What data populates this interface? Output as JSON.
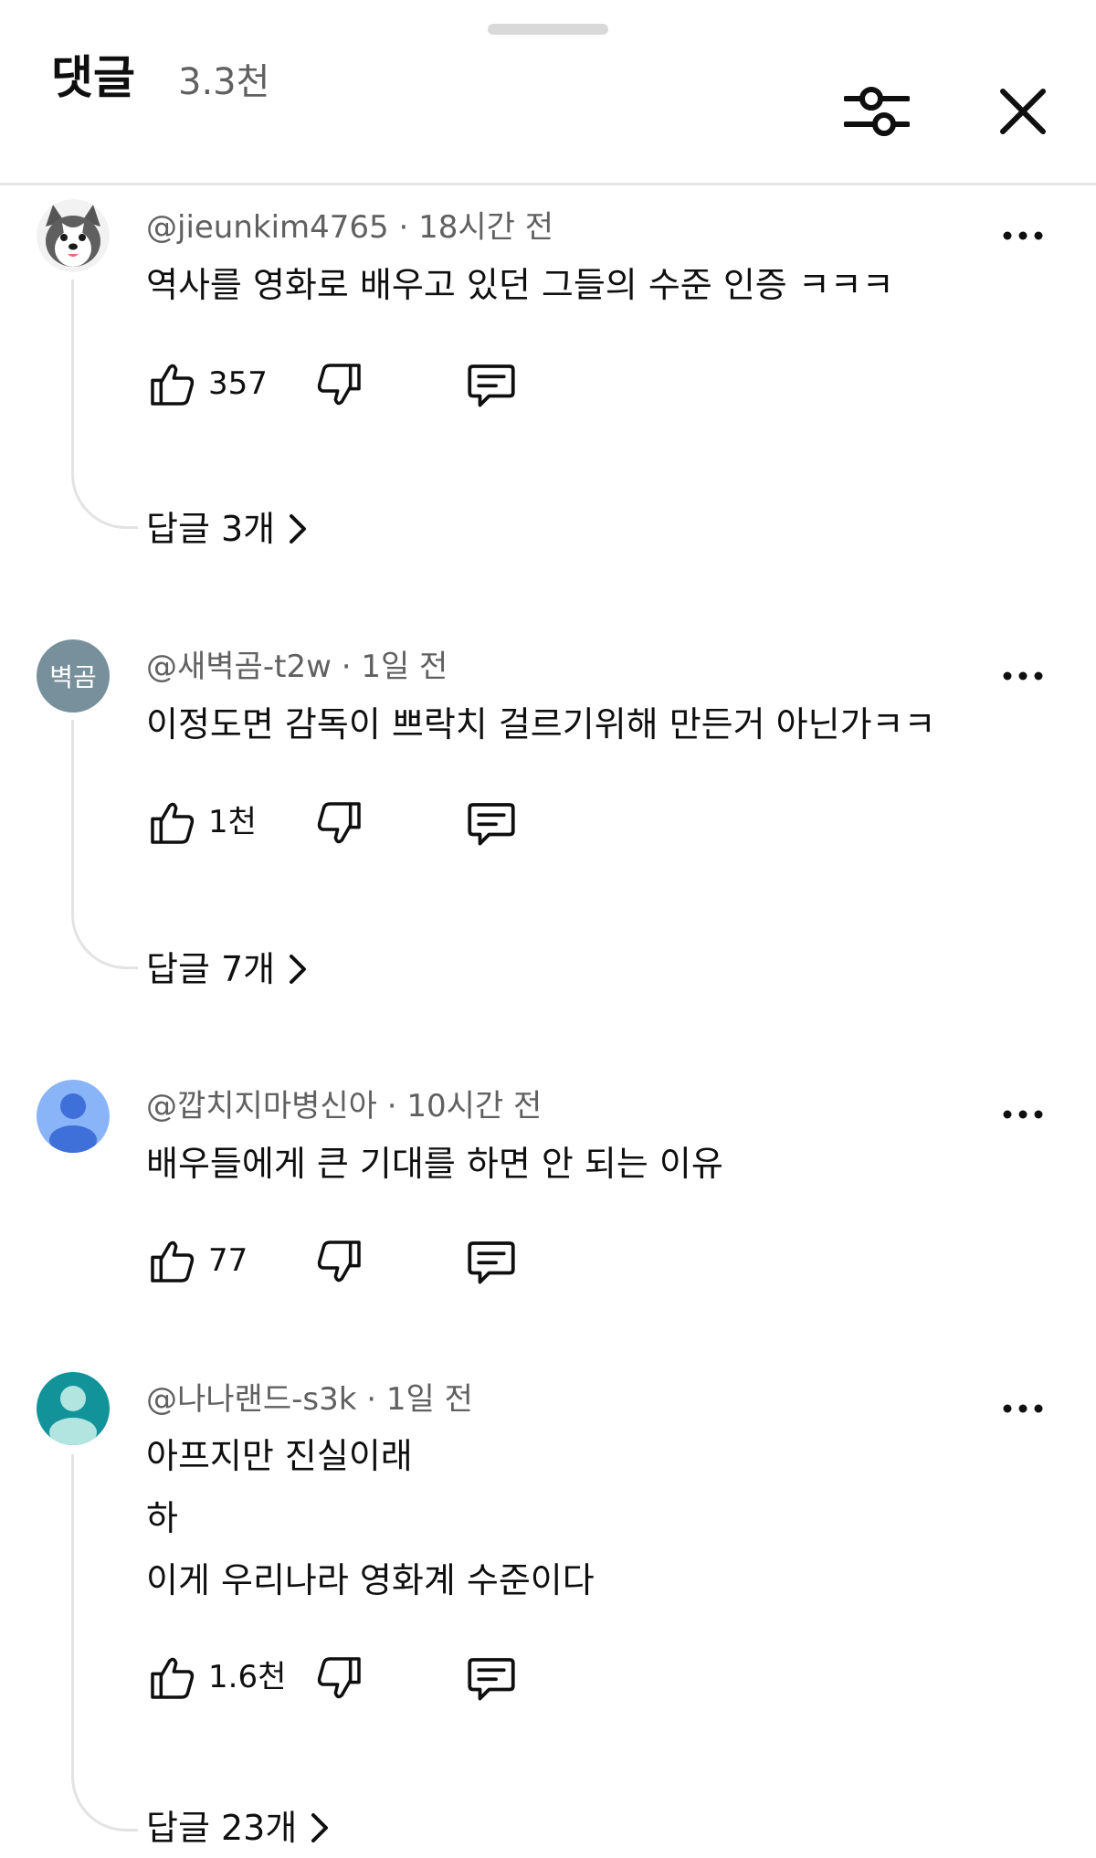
{
  "header": {
    "title": "댓글",
    "count": "3.3천",
    "filter_icon": "sliders-icon",
    "close_icon": "close-icon"
  },
  "comments": [
    {
      "author": "@jieunkim4765",
      "time": "· 18시간 전",
      "lines": [
        "역사를 영화로 배우고 있던 그들의 수준 인증 ㅋㅋㅋ"
      ],
      "likes": "357",
      "replies": "답글 3개",
      "avatar": {
        "type": "husky-character",
        "bg": "#ffffff"
      }
    },
    {
      "author": "@새벽곰-t2w",
      "time": "· 1일 전",
      "lines": [
        "이정도면 감독이 쁘락치 걸르기위해 만든거 아닌가ㅋㅋ"
      ],
      "likes": "1천",
      "replies": "답글 7개",
      "avatar": {
        "type": "text",
        "text": "벽곰",
        "bg": "#78909c"
      }
    },
    {
      "author": "@깝치지마병신아",
      "time": "· 10시간 전",
      "lines": [
        "배우들에게 큰 기대를 하면 안 되는 이유"
      ],
      "likes": "77",
      "avatar": {
        "type": "person",
        "bg": "#8ab4f8",
        "fg": "#3f6fd8"
      }
    },
    {
      "author": "@나나랜드-s3k",
      "time": "· 1일 전",
      "lines": [
        "아프지만 진실이래",
        "하",
        "이게 우리나라 영화계 수준이다"
      ],
      "likes": "1.6천",
      "replies": "답글 23개",
      "avatar": {
        "type": "person",
        "bg": "#12939a",
        "fg": "#b2e4e0"
      }
    }
  ],
  "colors": {
    "text": "#0f0f0f",
    "secondary": "#606060",
    "divider": "#e5e5e5"
  }
}
